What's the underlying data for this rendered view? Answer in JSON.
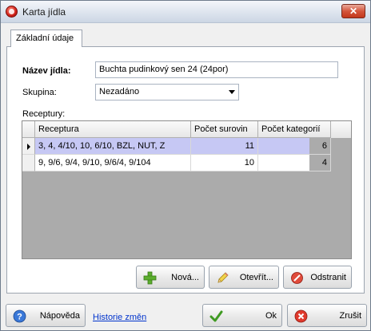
{
  "window": {
    "title": "Karta jídla",
    "close_glyph": "✕"
  },
  "tabs": [
    {
      "label": "Základní údaje"
    }
  ],
  "form": {
    "name_label": "Název jídla:",
    "name_value": "Buchta pudinkový sen 24 (24por)",
    "group_label": "Skupina:",
    "group_value": "Nezadáno",
    "recipes_label": "Receptury:"
  },
  "grid": {
    "columns": [
      "Receptura",
      "Počet surovin",
      "Počet kategorií"
    ],
    "rows": [
      {
        "recipe": "3, 4, 4/10, 10, 6/10, BZL, NUT, Z",
        "ingredients": "11",
        "categories": "6",
        "selected": true
      },
      {
        "recipe": "9, 9/6, 9/4, 9/10, 9/6/4, 9/104",
        "ingredients": "10",
        "categories": "4",
        "selected": false
      }
    ]
  },
  "grid_buttons": {
    "new": "Nová...",
    "open": "Otevřít...",
    "remove": "Odstranit"
  },
  "footer": {
    "help": "Nápověda",
    "history": "Historie změn",
    "ok": "Ok",
    "cancel": "Zrušit"
  },
  "colors": {
    "selected_row": "#c6c8f4",
    "grid_bg": "#ababab",
    "link": "#0033cc"
  },
  "icons": {
    "app": "app-icon",
    "close": "close-icon",
    "row_pointer": "row-pointer-icon",
    "new": "plus-icon",
    "open": "pencil-icon",
    "remove": "delete-icon",
    "help": "help-icon",
    "ok": "checkmark-icon",
    "cancel": "cancel-icon"
  }
}
